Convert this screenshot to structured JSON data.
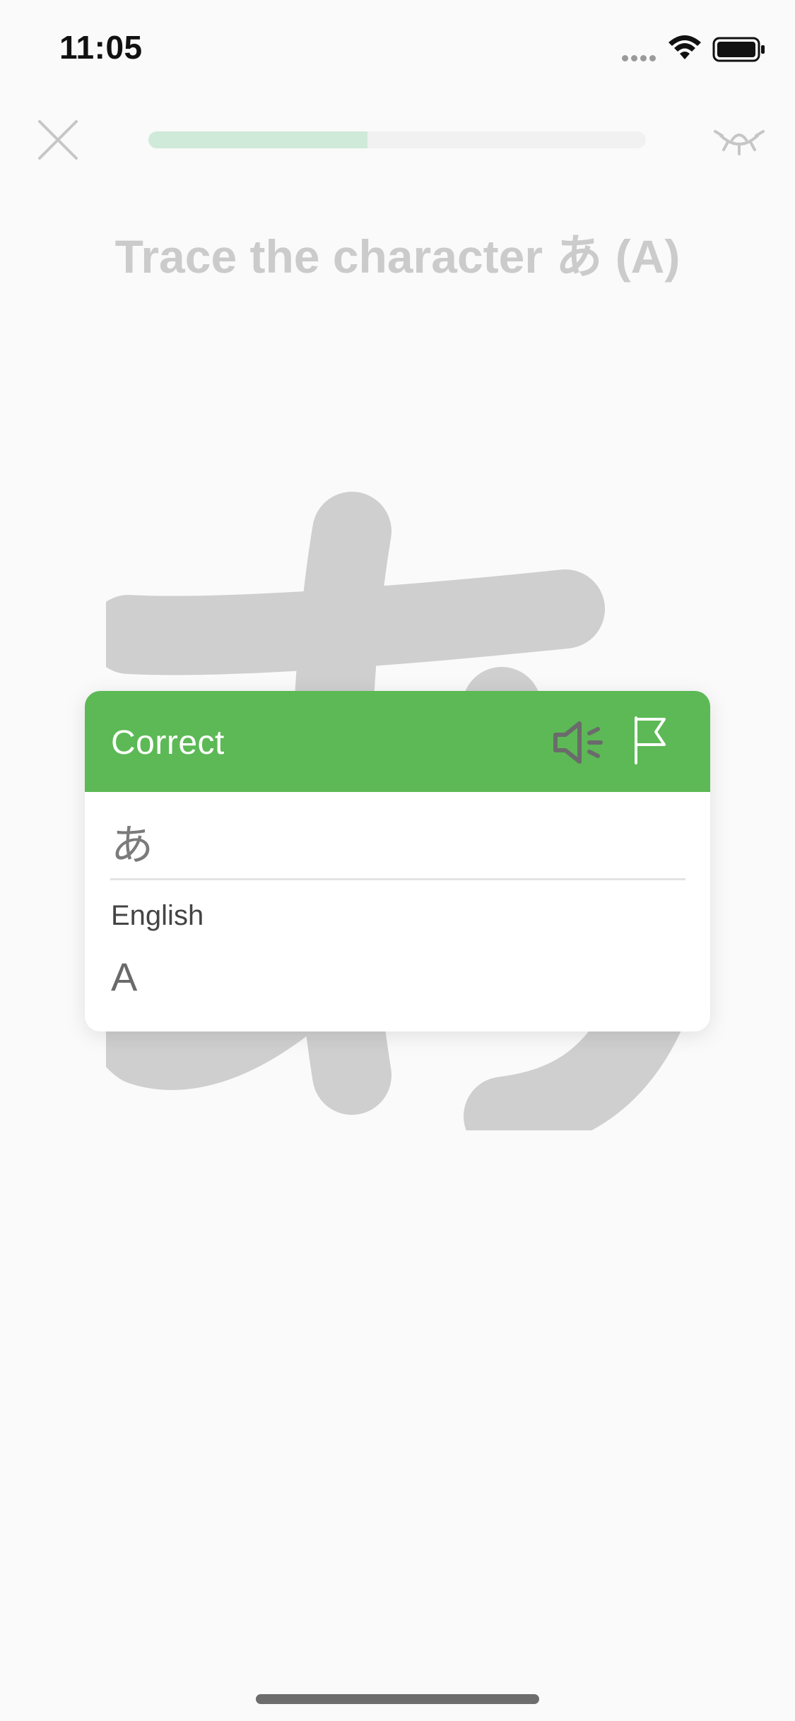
{
  "status_bar": {
    "time": "11:05"
  },
  "toolbar": {
    "close_icon": "close-icon",
    "progress_fraction": 0.44,
    "hide_icon": "eye-closed-icon"
  },
  "instruction": "Trace the character あ (A)",
  "trace": {
    "character": "あ"
  },
  "feedback": {
    "title": "Correct",
    "audio_icon": "speaker-icon",
    "flag_icon": "flag-icon",
    "answer": "あ",
    "translation_label": "English",
    "translation_value": "A",
    "header_color": "#5cb955"
  },
  "colors": {
    "progress_fill": "#cfead8",
    "stroke_gray": "#cfcfcf",
    "background": "#fafafa"
  }
}
